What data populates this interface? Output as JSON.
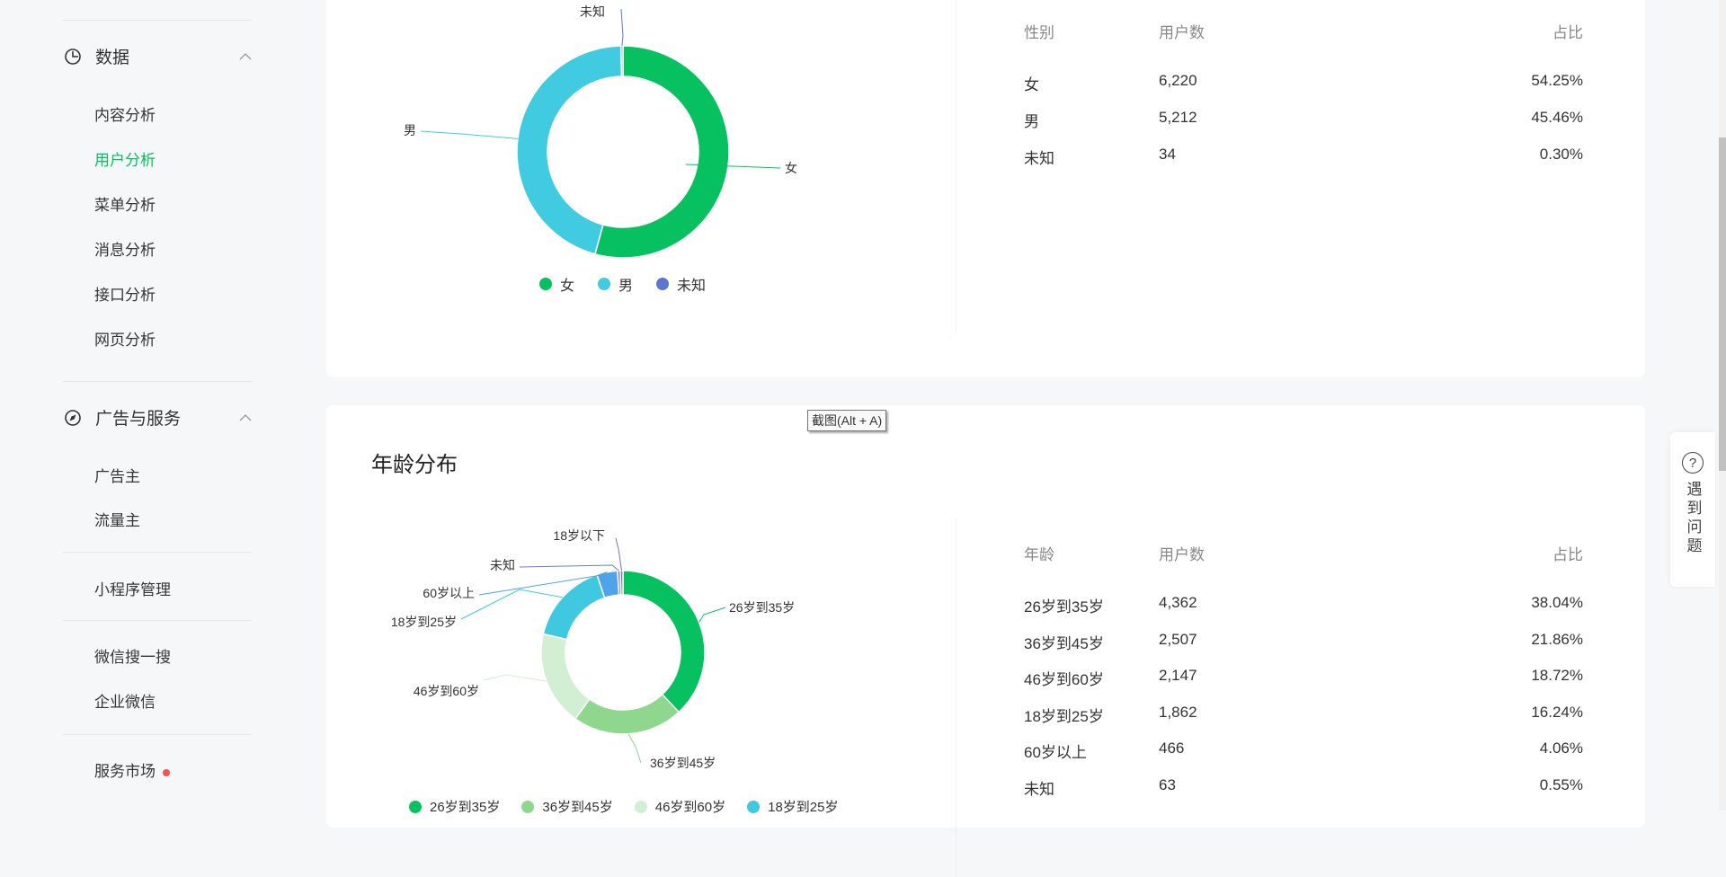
{
  "sidebar": {
    "data_group": "数据",
    "data_items": [
      "内容分析",
      "用户分析",
      "菜单分析",
      "消息分析",
      "接口分析",
      "网页分析"
    ],
    "ads_group": "广告与服务",
    "ads_items": [
      "广告主",
      "流量主"
    ],
    "miniprogram": "小程序管理",
    "search": "微信搜一搜",
    "work_wechat": "企业微信",
    "market": "服务市场"
  },
  "gender": {
    "headers": [
      "性别",
      "用户数",
      "占比"
    ],
    "rows": [
      [
        "女",
        "6,220",
        "54.25%"
      ],
      [
        "男",
        "5,212",
        "45.46%"
      ],
      [
        "未知",
        "34",
        "0.30%"
      ]
    ],
    "legend": [
      "女",
      "男",
      "未知"
    ]
  },
  "age": {
    "title": "年龄分布",
    "headers": [
      "年龄",
      "用户数",
      "占比"
    ],
    "rows": [
      [
        "26岁到35岁",
        "4,362",
        "38.04%"
      ],
      [
        "36岁到45岁",
        "2,507",
        "21.86%"
      ],
      [
        "46岁到60岁",
        "2,147",
        "18.72%"
      ],
      [
        "18岁到25岁",
        "1,862",
        "16.24%"
      ],
      [
        "60岁以上",
        "466",
        "4.06%"
      ],
      [
        "未知",
        "63",
        "0.55%"
      ]
    ],
    "legend": [
      "26岁到35岁",
      "36岁到45岁",
      "46岁到60岁",
      "18岁到25岁"
    ]
  },
  "chart_data": [
    {
      "type": "pie",
      "title": "性别",
      "categories": [
        "女",
        "男",
        "未知"
      ],
      "values": [
        54.25,
        45.46,
        0.3
      ],
      "colors": [
        "#07c160",
        "#40cbe0",
        "#5b78d0"
      ]
    },
    {
      "type": "pie",
      "title": "年龄分布",
      "categories": [
        "26岁到35岁",
        "36岁到45岁",
        "46岁到60岁",
        "18岁到25岁",
        "60岁以上",
        "未知",
        "18岁以下"
      ],
      "values": [
        38.04,
        21.86,
        18.72,
        16.24,
        4.06,
        0.55,
        0.53
      ],
      "colors": [
        "#07c160",
        "#8fd68f",
        "#d2efd4",
        "#40c8e0",
        "#4fa3e8",
        "#6d7fd2",
        "#7c6fc2"
      ]
    }
  ],
  "tooltip": "截图(Alt + A)",
  "help": "遇到问题",
  "help_icon": "?"
}
